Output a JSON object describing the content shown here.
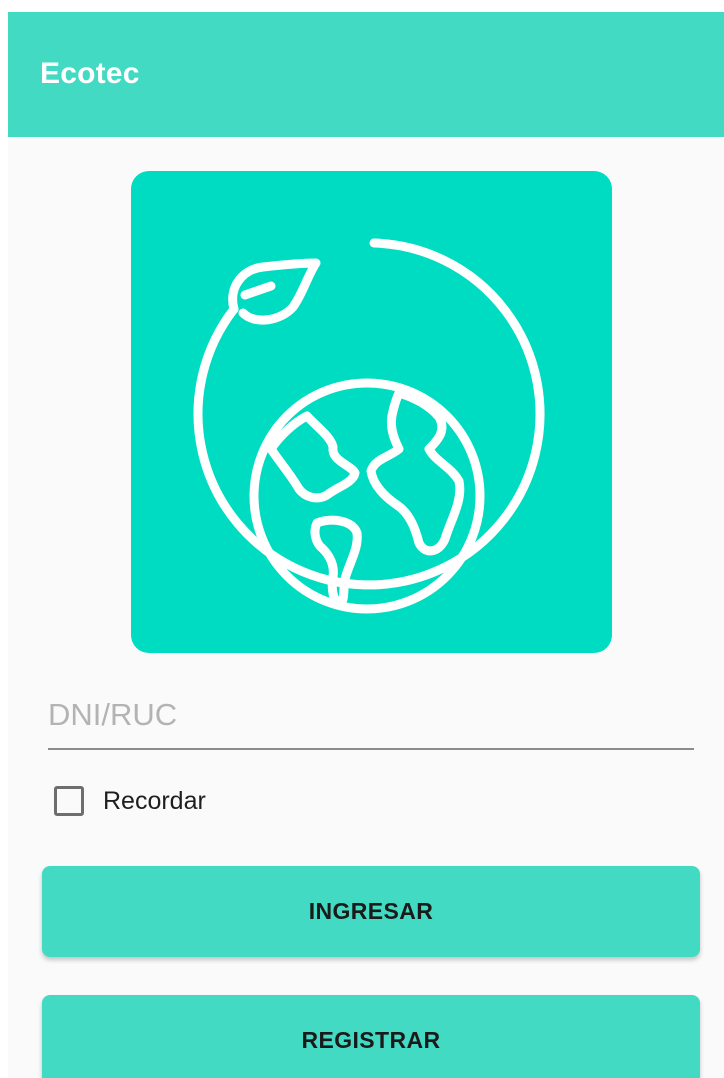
{
  "app_bar": {
    "title": "Ecotec",
    "color": "#43dac3"
  },
  "logo": {
    "icon": "earth-leaf-icon",
    "background_color": "#00dcc2"
  },
  "form": {
    "dni_placeholder": "DNI/RUC",
    "dni_value": "",
    "remember_label": "Recordar",
    "remember_checked": false
  },
  "buttons": {
    "login_label": "INGRESAR",
    "register_label": "REGISTRAR",
    "color": "#43dac3"
  }
}
